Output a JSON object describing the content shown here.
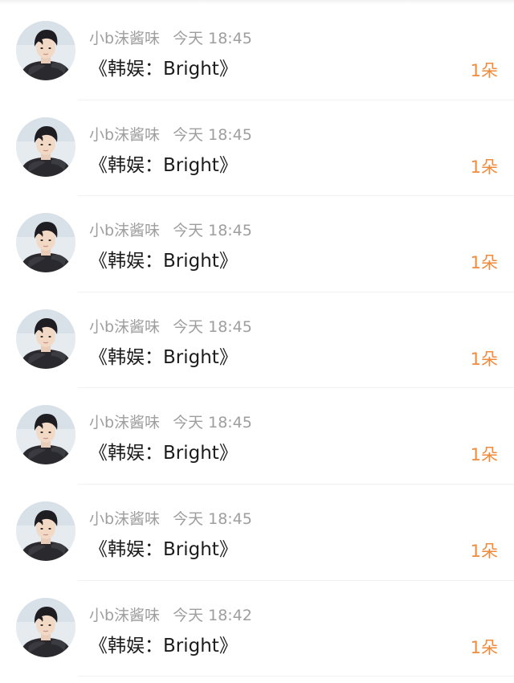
{
  "messages": [
    {
      "username": "小b沫酱味",
      "time": "今天 18:45",
      "title": "《韩娱：Bright》",
      "amount": "1朵"
    },
    {
      "username": "小b沫酱味",
      "time": "今天 18:45",
      "title": "《韩娱：Bright》",
      "amount": "1朵"
    },
    {
      "username": "小b沫酱味",
      "time": "今天 18:45",
      "title": "《韩娱：Bright》",
      "amount": "1朵"
    },
    {
      "username": "小b沫酱味",
      "time": "今天 18:45",
      "title": "《韩娱：Bright》",
      "amount": "1朵"
    },
    {
      "username": "小b沫酱味",
      "time": "今天 18:45",
      "title": "《韩娱：Bright》",
      "amount": "1朵"
    },
    {
      "username": "小b沫酱味",
      "time": "今天 18:45",
      "title": "《韩娱：Bright》",
      "amount": "1朵"
    },
    {
      "username": "小b沫酱味",
      "time": "今天 18:42",
      "title": "《韩娱：Bright》",
      "amount": "1朵"
    }
  ],
  "colors": {
    "accent": "#f08a3c",
    "meta_text": "#9e9e9e",
    "title_text": "#1c1c1c",
    "divider": "#f1f1f1"
  },
  "icons": {
    "avatar": "user-avatar-photo"
  }
}
